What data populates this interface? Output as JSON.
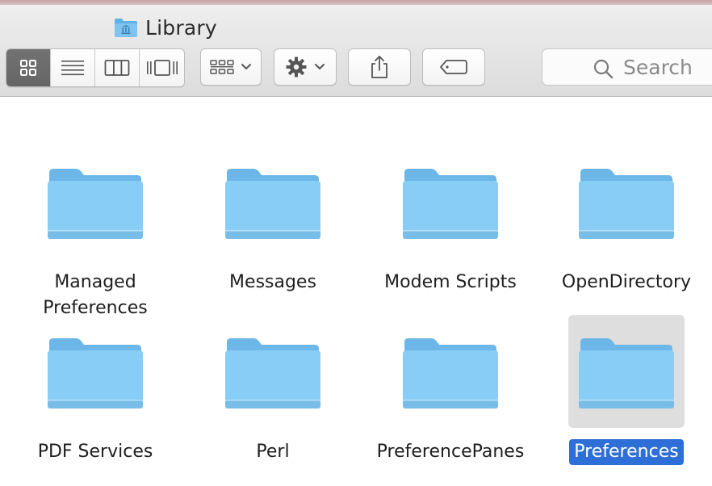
{
  "window": {
    "title": "Library"
  },
  "toolbar": {
    "view_modes": [
      "icon-view",
      "list-view",
      "column-view",
      "cover-flow-view"
    ],
    "active_view": "icon-view",
    "search_placeholder": "Search"
  },
  "colors": {
    "folder_blue": "#7fc4ef",
    "selection_blue": "#2d6fd6",
    "selection_gray": "#dedede"
  },
  "items": [
    {
      "label_line1": "Managed",
      "label_line2": "Preferences"
    },
    {
      "label_line1": "Messages",
      "label_line2": ""
    },
    {
      "label_line1": "Modem Scripts",
      "label_line2": ""
    },
    {
      "label_line1": "OpenDirectory",
      "label_line2": ""
    },
    {
      "label_line1": "PDF Services",
      "label_line2": ""
    },
    {
      "label_line1": "Perl",
      "label_line2": ""
    },
    {
      "label_line1": "PreferencePanes",
      "label_line2": ""
    },
    {
      "label_line1": "Preferences",
      "label_line2": "",
      "selected": true
    }
  ]
}
